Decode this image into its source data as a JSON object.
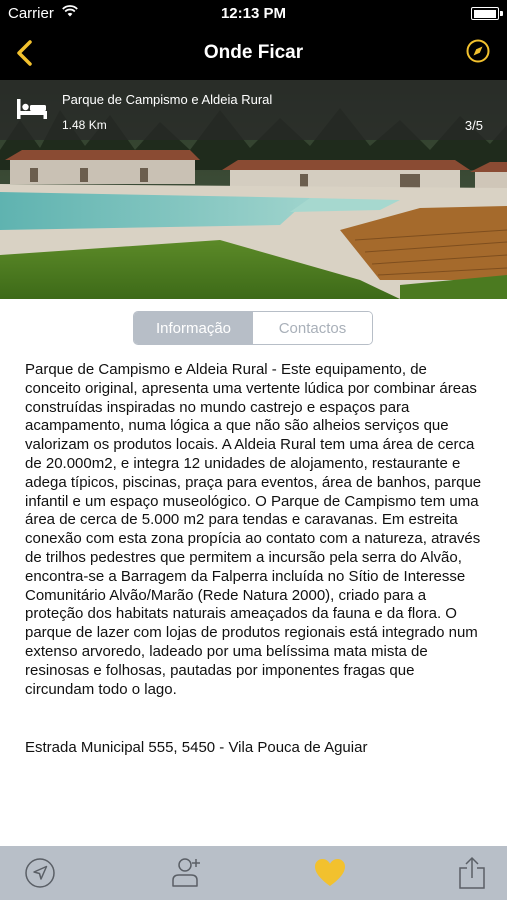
{
  "status_bar": {
    "carrier": "Carrier",
    "time": "12:13 PM"
  },
  "nav": {
    "title": "Onde Ficar",
    "back_icon": "chevron-left-icon",
    "right_icon": "compass-icon",
    "accent_color": "#f2c12e"
  },
  "hero": {
    "name": "Parque de Campismo e Aldeia Rural",
    "distance": "1.48 Km",
    "counter": "3/5",
    "icon": "bed-icon"
  },
  "tabs": [
    {
      "label": "Informação",
      "active": true
    },
    {
      "label": "Contactos",
      "active": false
    }
  ],
  "description": "Parque de Campismo e Aldeia Rural - Este equipamento, de conceito original, apresenta uma vertente lúdica por combinar áreas construídas inspiradas no mundo castrejo e espaços para acampamento, numa lógica a que não são alheios serviços que valorizam os produtos locais. A Aldeia Rural tem uma área de cerca de 20.000m2, e integra 12 unidades de alojamento, restaurante e adega típicos, piscinas, praça para eventos, área de banhos, parque infantil e um espaço museológico. O Parque de Campismo tem uma área de cerca de 5.000 m2 para tendas e caravanas. Em estreita conexão com esta zona propícia ao contato com a natureza, através de trilhos pedestres que permitem a incursão pela serra do Alvão, encontra-se a Barragem da Falperra incluída no Sítio de Interesse Comunitário Alvão/Marão (Rede Natura 2000), criado para a proteção dos habitats naturais ameaçados da fauna e da flora. O parque de lazer com lojas de produtos regionais está integrado num extenso arvoredo, ladeado por uma belíssima mata mista de resinosas e folhosas, pautadas por imponentes fragas que circundam todo o lago.",
  "address": "Estrada Municipal 555, 5450 - Vila Pouca de Aguiar",
  "toolbar": {
    "items": [
      "navigation-arrow-icon",
      "add-contact-icon",
      "heart-icon",
      "share-icon"
    ],
    "heart_color": "#f2c12e"
  }
}
